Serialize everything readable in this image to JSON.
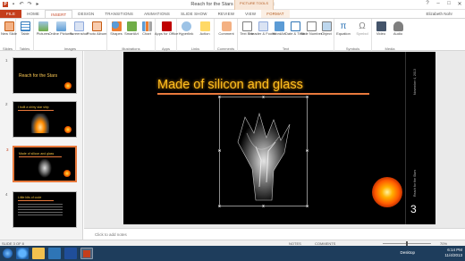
{
  "window": {
    "title": "Reach for the Stars EAN - PowerPoint",
    "context_tab_group": "PICTURE TOOLS",
    "controls": [
      "?",
      "–",
      "□",
      "✕"
    ]
  },
  "quick_access": [
    "save-icon",
    "undo-icon",
    "redo-icon",
    "start-from-beginning-icon"
  ],
  "tabs": [
    "FILE",
    "HOME",
    "INSERT",
    "DESIGN",
    "TRANSITIONS",
    "ANIMATIONS",
    "SLIDE SHOW",
    "REVIEW",
    "VIEW",
    "FORMAT"
  ],
  "active_tab": "INSERT",
  "user": "Elizabeth Nohr",
  "ribbon": {
    "groups": [
      {
        "label": "Slides",
        "buttons": [
          "New Slide"
        ]
      },
      {
        "label": "Tables",
        "buttons": [
          "Table"
        ]
      },
      {
        "label": "Images",
        "buttons": [
          "Pictures",
          "Online Pictures",
          "Screenshot",
          "Photo Album"
        ]
      },
      {
        "label": "Illustrations",
        "buttons": [
          "Shapes",
          "SmartArt",
          "Chart"
        ]
      },
      {
        "label": "Apps",
        "buttons": [
          "Apps for Office"
        ]
      },
      {
        "label": "Links",
        "buttons": [
          "Hyperlink",
          "Action"
        ]
      },
      {
        "label": "Comments",
        "buttons": [
          "Comment"
        ]
      },
      {
        "label": "Text",
        "buttons": [
          "Text Box",
          "Header & Footer",
          "WordArt",
          "Date & Time",
          "Slide Number",
          "Object"
        ]
      },
      {
        "label": "Symbols",
        "buttons": [
          "Equation",
          "Symbol"
        ]
      },
      {
        "label": "Media",
        "buttons": [
          "Video",
          "Audio"
        ]
      }
    ]
  },
  "thumbnails": [
    {
      "num": "1",
      "title": "Reach for the Stars"
    },
    {
      "num": "2",
      "title": "I built a shiny star ship"
    },
    {
      "num": "3",
      "title": "Made of silicon and glass"
    },
    {
      "num": "4",
      "title": "Little bits of code"
    }
  ],
  "slide": {
    "title": "Made of silicon and glass",
    "date_vertical": "November 4, 2013",
    "footer_vertical": "Reach for the Stars",
    "number": "3"
  },
  "notes_placeholder": "Click to add notes",
  "status": {
    "slide_of": "SLIDE 3 OF 8",
    "notes": "NOTES",
    "comments": "COMMENTS",
    "zoom": "70%"
  },
  "taskbar": {
    "apps": [
      "ie-icon",
      "explorer-icon",
      "outlook-icon",
      "word-icon",
      "powerpoint-icon"
    ],
    "desktop_label": "Desktop",
    "time": "6:14 PM",
    "date": "11/4/2013"
  },
  "colors": {
    "accent": "#c43e1c",
    "title_gold": "#ffc020",
    "rule_orange": "#e8793c"
  }
}
